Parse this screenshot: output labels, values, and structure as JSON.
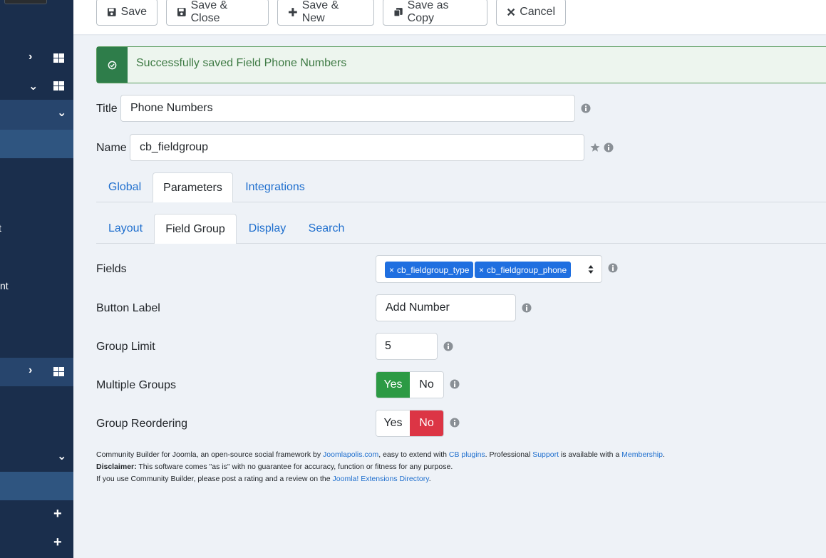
{
  "toolbar": {
    "save": "Save",
    "save_close": "Save & Close",
    "save_new": "Save & New",
    "save_copy": "Save as Copy",
    "cancel": "Cancel"
  },
  "alert": {
    "message": "Successfully saved Field Phone Numbers",
    "color": "#2e7d4a"
  },
  "form": {
    "title_label": "Title",
    "title_value": "Phone Numbers",
    "name_label": "Name",
    "name_value": "cb_fieldgroup"
  },
  "tabs": [
    "Global",
    "Parameters",
    "Integrations"
  ],
  "subtabs": [
    "Layout",
    "Field Group",
    "Display",
    "Search"
  ],
  "params": {
    "fields_label": "Fields",
    "fields_chips": [
      "cb_fieldgroup_type",
      "cb_fieldgroup_phone"
    ],
    "button_label_label": "Button Label",
    "button_label_value": "Add Number",
    "group_limit_label": "Group Limit",
    "group_limit_value": "5",
    "multiple_groups_label": "Multiple Groups",
    "group_reordering_label": "Group Reordering",
    "yes": "Yes",
    "no": "No"
  },
  "sidebar": {
    "frag1": "t",
    "frag2": "nt"
  },
  "footer": {
    "l1_a": "Community Builder for Joomla, an open-source social framework by ",
    "l1_link1": "Joomlapolis.com",
    "l1_b": ", easy to extend with ",
    "l1_link2": "CB plugins",
    "l1_c": ". Professional ",
    "l1_link3": "Support",
    "l1_d": " is available with a ",
    "l1_link4": "Membership",
    "l1_e": ".",
    "l2_bold": "Disclaimer:",
    "l2_text": " This software comes \"as is\" with no guarantee for accuracy, function or fitness for any purpose.",
    "l3_a": "If you use Community Builder, please post a rating and a review on the ",
    "l3_link": "Joomla! Extensions Directory",
    "l3_b": "."
  },
  "colors": {
    "sidebar": "#1a2e4c",
    "accent": "#1f6fce",
    "success": "#2c9a44",
    "danger": "#dc3545"
  }
}
